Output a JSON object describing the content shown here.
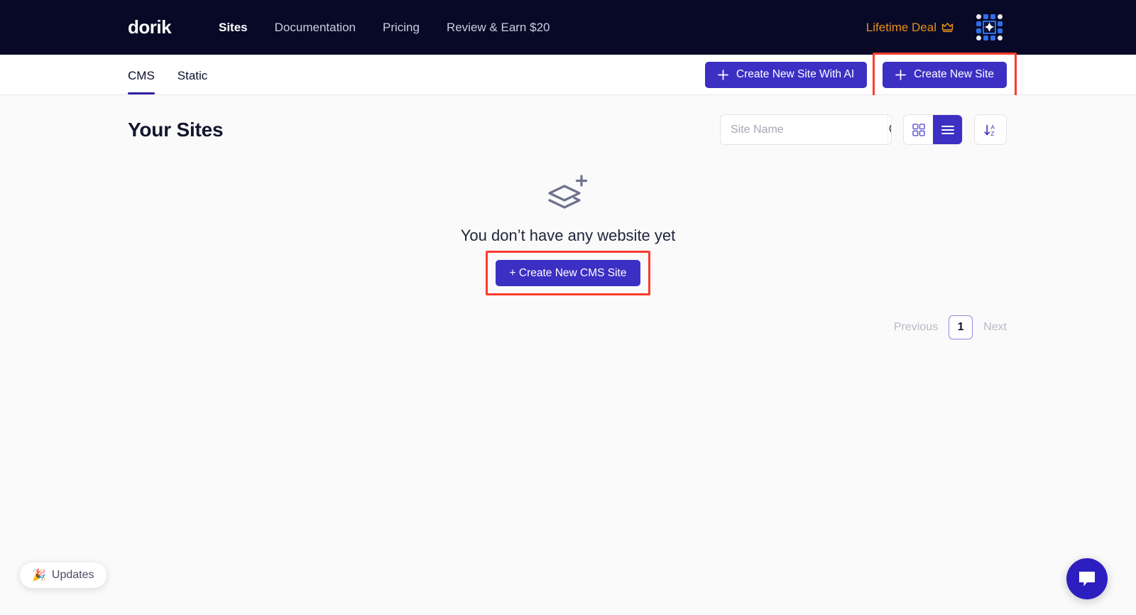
{
  "topnav": {
    "logo": "dorik",
    "links": [
      {
        "label": "Sites",
        "active": true
      },
      {
        "label": "Documentation",
        "active": false
      },
      {
        "label": "Pricing",
        "active": false
      },
      {
        "label": "Review & Earn $20",
        "active": false
      }
    ],
    "lifetime_deal": "Lifetime Deal",
    "crown_icon": "crown-icon",
    "avatar_icon": "avatar-icon"
  },
  "tabbar": {
    "tabs": [
      {
        "label": "CMS",
        "active": true
      },
      {
        "label": "Static",
        "active": false
      }
    ],
    "create_with_ai_label": "Create New Site With AI",
    "create_site_label": "Create New Site",
    "plus_icon": "plus-icon"
  },
  "main": {
    "title": "Your Sites",
    "search": {
      "placeholder": "Site Name",
      "value": "",
      "icon": "search-icon"
    },
    "view_toggle": {
      "grid_icon": "grid-view-icon",
      "list_icon": "list-view-icon",
      "active": "list"
    },
    "sort": {
      "icon": "sort-az-icon"
    },
    "empty": {
      "icon": "layers-plus-icon",
      "message": "You don’t have any website yet",
      "cta_label": "+ Create New CMS Site"
    },
    "pagination": {
      "previous": "Previous",
      "current_page": "1",
      "next": "Next"
    }
  },
  "floating": {
    "updates_label": "Updates",
    "updates_icon": "party-popper-icon",
    "chat_icon": "chat-bubble-icon"
  },
  "colors": {
    "nav_bg": "#080926",
    "accent": "#3c2fc4",
    "highlight": "#fc3b2d",
    "gold": "#e8901a",
    "page_bg": "#fafafa"
  }
}
